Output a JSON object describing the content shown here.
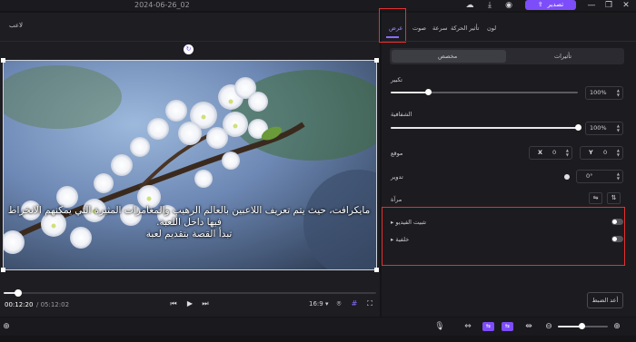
{
  "window": {
    "title": "2024-06-26_02",
    "export_label": "تصدير",
    "colors": {
      "accent": "#7d4dfa",
      "highlight": "#e53030"
    }
  },
  "player": {
    "label": "لاعب",
    "subtitle_line1": "مايكرافت، حيث يتم تعريف اللاعبين بالعالم الرهيب والمغامرات المثيرة التي يمكنهم الانخراط فيها داخل اللعبة.",
    "subtitle_line2": "تبدأ القصة بتقديم لعبة",
    "time_current": "00:12:20",
    "time_total": "/ 05:12:02",
    "progress": 0.04,
    "aspect_ratio": "16:9 ▾"
  },
  "panel": {
    "tabs": [
      {
        "label": "عرض",
        "active": true
      },
      {
        "label": "صوت"
      },
      {
        "label": "سرعة"
      },
      {
        "label": "تأثير الحركة"
      },
      {
        "label": "لون"
      }
    ],
    "segments": {
      "custom": "مخصص",
      "effects": "تأثيرات"
    },
    "scale": {
      "label": "تكبير",
      "value": "100%",
      "fraction": 1.0
    },
    "opacity": {
      "label": "الشفافية",
      "value": "100%",
      "fraction": 1.0
    },
    "position": {
      "label": "موقع",
      "x_label": "X",
      "x_value": "0",
      "y_label": "Y",
      "y_value": "0"
    },
    "rotation": {
      "label": "تدوير",
      "value": "0°"
    },
    "mirror": {
      "label": "مرآة"
    },
    "stabilize": {
      "label": "تثبيت الفيديو",
      "on": false
    },
    "background": {
      "label": "خلفية",
      "on": false
    },
    "reset_label": "أعد الضبط"
  }
}
